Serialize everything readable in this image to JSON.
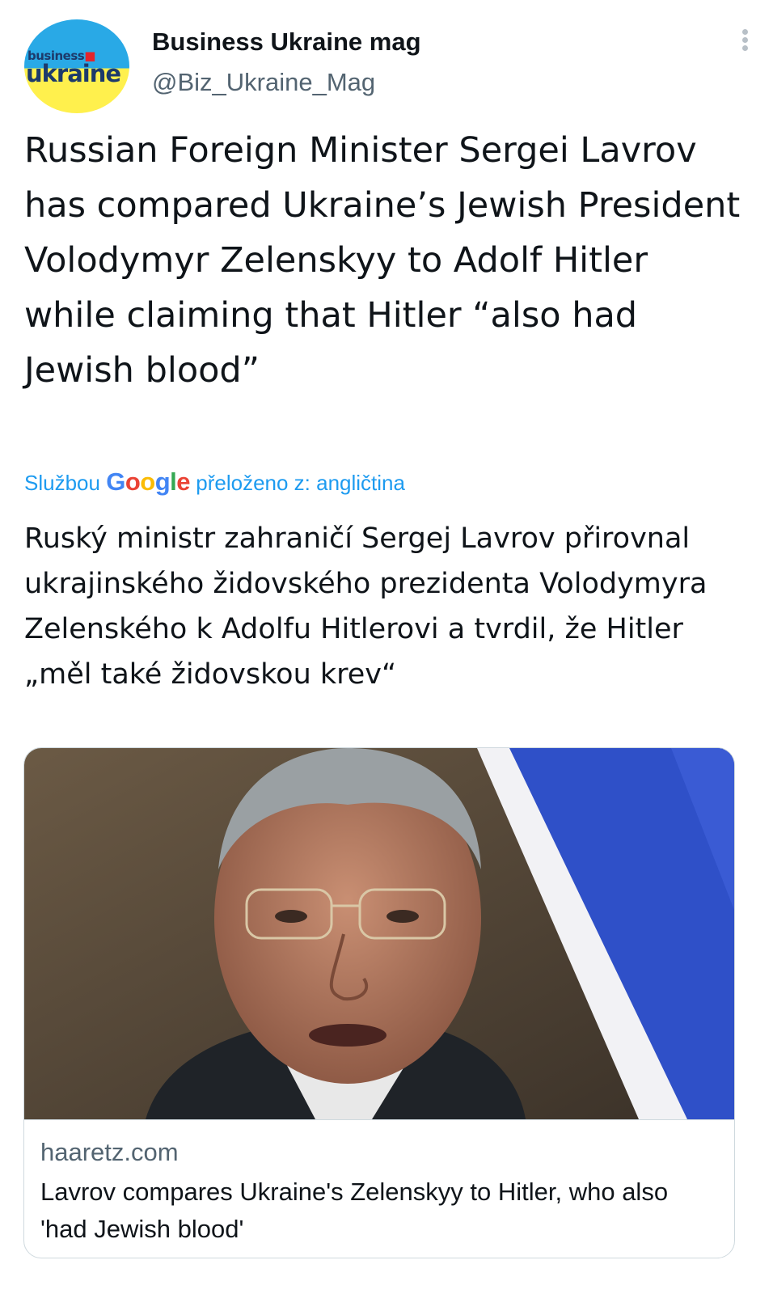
{
  "author": {
    "display_name": "Business Ukraine mag",
    "handle": "@Biz_Ukraine_Mag",
    "avatar_logo_small": "business",
    "avatar_logo_big": "ukraine",
    "avatar_colors": [
      "#29a9e6",
      "#fff04d"
    ]
  },
  "tweet": {
    "text": "Russian Foreign Minister Sergei Lavrov has compared Ukraine’s Jewish President Volodymyr Zelenskyy to Adolf Hitler while claiming that Hitler “also had Jewish blood”",
    "translation_prefix": "Službou",
    "translation_provider": "Google",
    "translation_suffix": "přeloženo z: angličtina",
    "translated_text": "Ruský ministr zahraničí Sergej Lavrov přirovnal ukrajinského židovského prezidenta Volodymyra Zelenského k Adolfu Hitlerovi a tvrdil, že Hitler „měl také židovskou krev“"
  },
  "link_card": {
    "domain": "haaretz.com",
    "title": "Lavrov compares Ukraine's Zelenskyy to Hitler, who also 'had Jewish blood'"
  },
  "icons": {
    "more": "more-vertical-icon"
  },
  "colors": {
    "link_blue": "#1d9bf0",
    "secondary_text": "#536471",
    "border": "#cfd9de"
  }
}
